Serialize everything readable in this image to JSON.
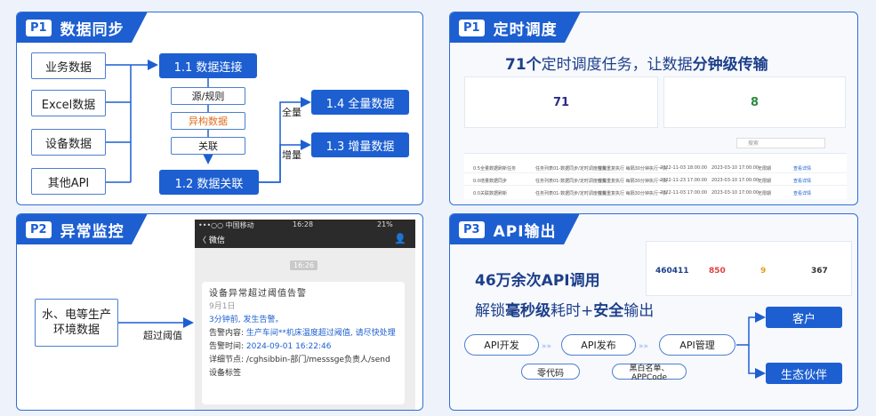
{
  "p1": {
    "badge": "P1",
    "title": "数据同步",
    "sources": [
      "业务数据",
      "Excel数据",
      "设备数据",
      "其他API"
    ],
    "connect": "1.1 数据连接",
    "steps": [
      "源/规则",
      "异构数据",
      "关联"
    ],
    "relate": "1.2  数据关联",
    "full": "1.4  全量数据",
    "inc": "1.3  增量数据",
    "full_label": "全量",
    "inc_label": "增量"
  },
  "p1b": {
    "badge": "P1",
    "title": "定时调度",
    "headline_pre": "71个",
    "headline_mid": "定时调度任务，让数据",
    "headline_strong": "分钟级传输",
    "stat1_value": "71",
    "stat2_value": "8",
    "search_placeholder": "搜索",
    "rows": [
      {
        "c1": "0.5全量数据刷新任务",
        "c2": "任务列表01-数据同步/定时调度任务",
        "c3": "按需重复执行 每隔30分钟执行一次",
        "c4": "2022-11-03 18:00:00",
        "c5": "2023-03-10 17:00:00",
        "c6": "无限期",
        "c7": "查看详情"
      },
      {
        "c1": "0.0增量数据同步",
        "c2": "任务列表01-数据同步/定时调度任务",
        "c3": "按需重复执行 每隔30分钟执行一次",
        "c4": "2022-11-23 17:00:00",
        "c5": "2023-03-10 17:00:00",
        "c6": "无限期",
        "c7": "查看详情"
      },
      {
        "c1": "0.0关联数据刷新",
        "c2": "任务列表01-数据同步/定时调度任务",
        "c3": "按需重复执行 每隔30分钟执行一次",
        "c4": "2022-11-03 17:00:00",
        "c5": "2023-03-10 17:00:00",
        "c6": "无限期",
        "c7": "查看详情"
      }
    ]
  },
  "p2": {
    "badge": "P2",
    "title": "异常监控",
    "env_box": "水、电等生产\n环境数据",
    "threshold_label": "超过阈值",
    "phone": {
      "carrier": "•••○○ 中国移动",
      "time": "16:28",
      "battery": "21%",
      "back": "〈 微信",
      "msg_time": "16:26",
      "card_title": "设备异常超过阈值告警",
      "card_date": "9月1日",
      "card_line1": "3分钟前, 发生告警。",
      "card_content_label": "告警内容: ",
      "card_content": "生产车间**机床温度超过阈值, 请尽快处理",
      "card_time_label": "告警时间: ",
      "card_time": "2024-09-01 16:22:46",
      "card_detail_label": "详细节点: ",
      "card_detail": "/cghsibbin-部门/messsge负责人/send设备标签"
    }
  },
  "p3": {
    "badge": "P3",
    "title": "API输出",
    "headline1": "46万余次API调用",
    "headline2_a": "解锁",
    "headline2_b": "毫秒级",
    "headline2_c": "耗时+",
    "headline2_d": "安全",
    "headline2_e": "输出",
    "stats": [
      "460411",
      "850",
      "9",
      "367"
    ],
    "flow": [
      "API开发",
      "API发布",
      "API管理"
    ],
    "bottom": [
      "零代码",
      "黑白名单、APPCode"
    ],
    "targets": [
      "客户",
      "生态伙伴"
    ]
  }
}
